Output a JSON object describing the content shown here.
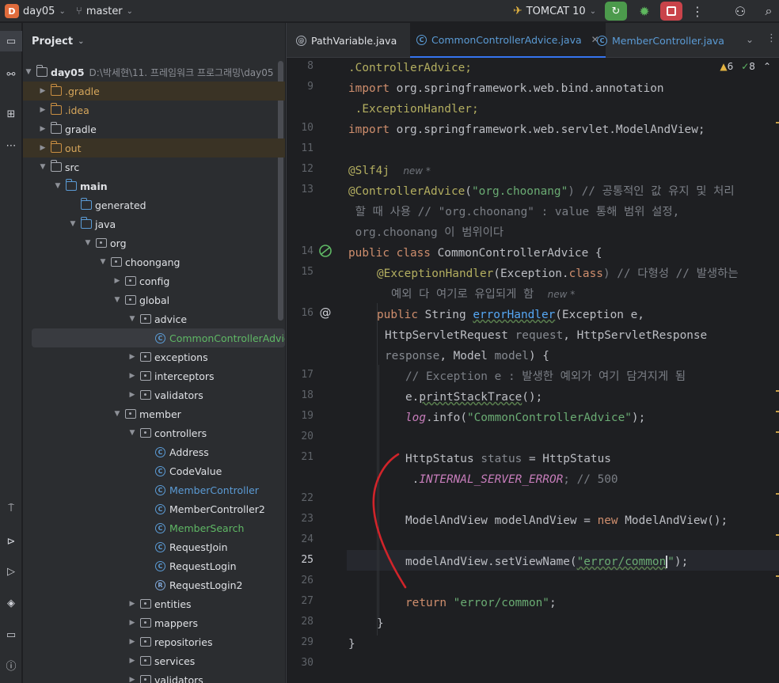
{
  "topbar": {
    "project_badge": "D",
    "project_name": "day05",
    "branch": "master",
    "run_config": "TOMCAT 10"
  },
  "project_panel": {
    "title": "Project",
    "root_name": "day05",
    "root_path": "D:\\박세현\\11. 프레임워크 프로그래밍\\day05",
    "nodes": {
      "gradle_hidden": ".gradle",
      "idea": ".idea",
      "gradle": "gradle",
      "out": "out",
      "src": "src",
      "main": "main",
      "generated": "generated",
      "java": "java",
      "org": "org",
      "choongang": "choongang",
      "config": "config",
      "global": "global",
      "advice": "advice",
      "common_controller_advice": "CommonControllerAdvice",
      "exceptions": "exceptions",
      "interceptors": "interceptors",
      "validators": "validators",
      "member": "member",
      "controllers": "controllers",
      "address": "Address",
      "code_value": "CodeValue",
      "member_controller": "MemberController",
      "member_controller2": "MemberController2",
      "member_search": "MemberSearch",
      "request_join": "RequestJoin",
      "request_login": "RequestLogin",
      "request_login2": "RequestLogin2",
      "entities": "entities",
      "mappers": "mappers",
      "repositories": "repositories",
      "services": "services",
      "validators2": "validators"
    }
  },
  "editor": {
    "tabs": [
      {
        "label": "PathVariable.java"
      },
      {
        "label": "CommonControllerAdvice.java"
      },
      {
        "label": "MemberController.java"
      }
    ],
    "inspections": {
      "warnings": "6",
      "ok": "8"
    },
    "line_numbers": [
      "8",
      "9",
      "10",
      "11",
      "12",
      "13",
      "14",
      "15",
      "16",
      "17",
      "18",
      "19",
      "20",
      "21",
      "22",
      "23",
      "24",
      "25",
      "26",
      "27",
      "28",
      "29",
      "30"
    ],
    "code": {
      "l8": ".ControllerAdvice;",
      "l9a": "import ",
      "l9b": "org.springframework.web.bind.annotation",
      "l9c": " .ExceptionHandler;",
      "l10a": "import ",
      "l10b": "org.springframework.web.servlet.ModelAndView;",
      "l12a": "@Slf4j",
      "l12hint": "new *",
      "l13a": "@ControllerAdvice",
      "l13b": "(",
      "l13c": "\"org.choonang\"",
      "l13d": ") // 공통적인 값 유지 및 처리",
      "l13e": " 할 때 사용 // \"org.choonang\" : value 통해 범위 설정,",
      "l13f": " org.choonang 이 범위이다",
      "l14a": "public class ",
      "l14b": "CommonControllerAdvice {",
      "l15a": "@ExceptionHandler",
      "l15b": "(Exception.",
      "l15c": "class",
      "l15d": ") // 다형성 // 발생하는",
      "l15e": "예외 다 여기로 유입되게 함",
      "l15hint": "new *",
      "l16a": "public ",
      "l16b": "String ",
      "l16c": "errorHandler",
      "l16d": "(Exception e,",
      "l16e": "HttpServletRequest ",
      "l16f": "request",
      "l16g": ", HttpServletResponse",
      "l16h": "response",
      "l16i": ", Model ",
      "l16j": "model",
      "l16k": ") {",
      "l17": "// Exception e : 발생한 예외가 여기 담겨지게 됨",
      "l18a": "e.",
      "l18b": "printStackTrace",
      "l18c": "();",
      "l19a": "log",
      "l19b": ".info(",
      "l19c": "\"CommonControllerAdvice\"",
      "l19d": ");",
      "l21a": "HttpStatus ",
      "l21b": "status",
      "l21c": " = HttpStatus",
      "l21d": " .",
      "l21e": "INTERNAL_SERVER_ERROR",
      "l21f": "; // 500",
      "l23a": "ModelAndView modelAndView = ",
      "l23b": "new ",
      "l23c": "ModelAndView();",
      "l25a": "modelAndView.setViewName(",
      "l25b": "\"error/common",
      "l25c": "\"",
      "l25d": ");",
      "l27a": "return ",
      "l27b": "\"error/common\"",
      "l27c": ";",
      "l28": "}",
      "l29": "}"
    }
  },
  "colors": {
    "accent": "#3574f0",
    "annotation_mark": "#d0242a"
  }
}
